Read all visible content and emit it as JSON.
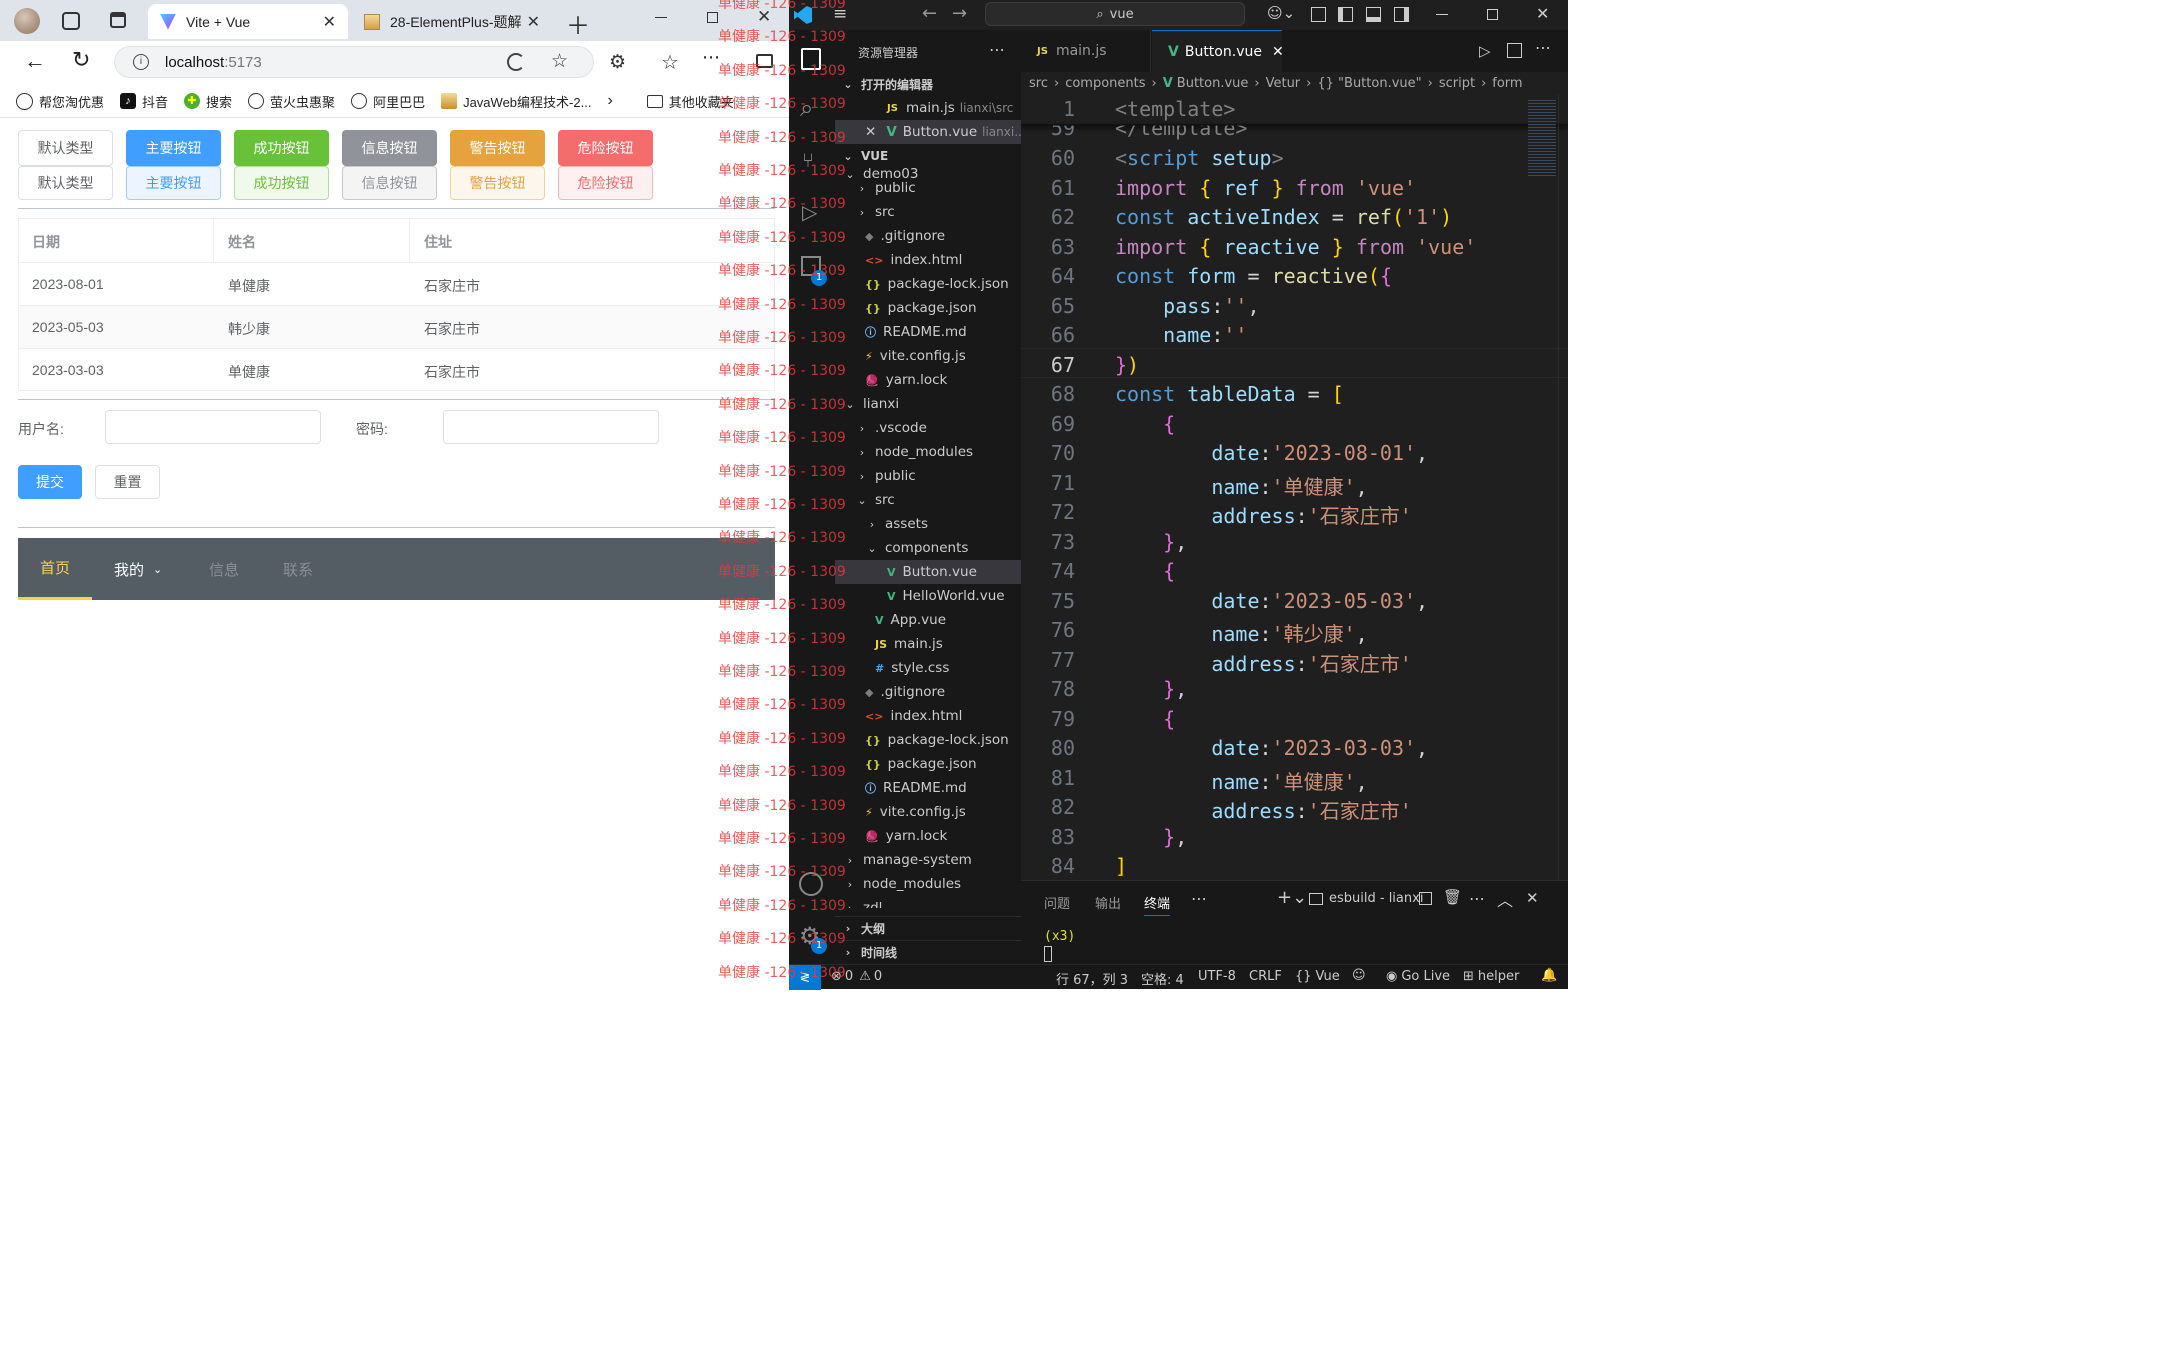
{
  "browser": {
    "tabs": [
      {
        "title": "Vite + Vue",
        "active": true
      },
      {
        "title": "28-ElementPlus-题解",
        "active": false
      }
    ],
    "url_host": "localhost",
    "url_port": ":5173",
    "bookmarks": [
      "帮您淘优惠",
      "抖音",
      "搜索",
      "萤火虫惠聚",
      "阿里巴巴",
      "JavaWeb编程技术-2..."
    ],
    "other_bookmarks": "其他收藏夹"
  },
  "page": {
    "plain_buttons": [
      "默认类型",
      "主要按钮",
      "成功按钮",
      "信息按钮",
      "警告按钮",
      "危险按钮"
    ],
    "light_buttons": [
      "默认类型",
      "主要按钮",
      "成功按钮",
      "信息按钮",
      "警告按钮",
      "危险按钮"
    ],
    "table": {
      "headers": [
        "日期",
        "姓名",
        "住址"
      ],
      "rows": [
        [
          "2023-08-01",
          "单健康",
          "石家庄市"
        ],
        [
          "2023-05-03",
          "韩少康",
          "石家庄市"
        ],
        [
          "2023-03-03",
          "单健康",
          "石家庄市"
        ]
      ]
    },
    "form": {
      "username_label": "用户名:",
      "password_label": "密码:",
      "submit": "提交",
      "reset": "重置"
    },
    "menu": {
      "items": [
        "首页",
        "我的",
        "信息",
        "联系"
      ]
    }
  },
  "watermark": "单健康 -126 - 1309",
  "vscode": {
    "search": "vue",
    "explorer_title": "资源管理器",
    "open_editors_label": "打开的编辑器",
    "open_editors": [
      {
        "name": "main.js",
        "path": "lianxi\\src"
      },
      {
        "name": "Button.vue",
        "path": "lianxi..."
      }
    ],
    "workspace": "VUE",
    "tree": [
      "demo03",
      "public",
      "src",
      ".gitignore",
      "index.html",
      "package-lock.json",
      "package.json",
      "README.md",
      "vite.config.js",
      "yarn.lock",
      "lianxi",
      ".vscode",
      "node_modules",
      "public",
      "src",
      "assets",
      "components",
      "Button.vue",
      "HelloWorld.vue",
      "App.vue",
      "main.js",
      "style.css",
      ".gitignore",
      "index.html",
      "package-lock.json",
      "package.json",
      "README.md",
      "vite.config.js",
      "yarn.lock",
      "manage-system",
      "node_modules",
      "zdl"
    ],
    "outline": "大纲",
    "timeline": "时间线",
    "editor_tabs": [
      "main.js",
      "Button.vue"
    ],
    "breadcrumb": [
      "src",
      "components",
      "Button.vue",
      "Vetur",
      "{} \"Button.vue\"",
      "script",
      "form"
    ],
    "line_numbers": [
      "1",
      "59",
      "60",
      "61",
      "62",
      "63",
      "64",
      "65",
      "66",
      "67",
      "68",
      "69",
      "70",
      "71",
      "72",
      "73",
      "74",
      "75",
      "76",
      "77",
      "78",
      "79",
      "80",
      "81",
      "82",
      "83",
      "84"
    ],
    "code_line1": "<template>",
    "code_line59": "</template>",
    "panel_tabs": [
      "问题",
      "输出",
      "终端"
    ],
    "terminal_name": "esbuild - lianxi",
    "terminal_text": "(x3)",
    "status": {
      "errors": "0",
      "warnings": "0",
      "position": "行 67，列 3",
      "spaces": "空格: 4",
      "encoding": "UTF-8",
      "eol": "CRLF",
      "lang": "Vue",
      "golive": "Go Live",
      "helper": "helper"
    },
    "badges": {
      "extensions": "1",
      "settings": "1"
    }
  }
}
